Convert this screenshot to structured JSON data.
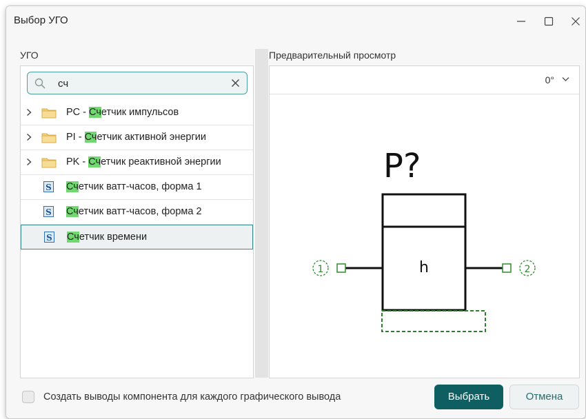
{
  "window": {
    "title": "Выбор УГО"
  },
  "left_panel": {
    "label": "УГО",
    "search": {
      "value": "сч"
    },
    "items": [
      {
        "type": "folder",
        "prefix": "PC - ",
        "match": "Сч",
        "rest": "етчик импульсов",
        "icon": "folder-icon",
        "expandable": true
      },
      {
        "type": "folder",
        "prefix": "PI - ",
        "match": "Сч",
        "rest": "етчик активной энергии",
        "icon": "folder-icon",
        "expandable": true
      },
      {
        "type": "folder",
        "prefix": "PK - ",
        "match": "Сч",
        "rest": "етчик реактивной энергии",
        "icon": "folder-icon",
        "expandable": true
      },
      {
        "type": "symbol",
        "prefix": "",
        "match": "Сч",
        "rest": "етчик ватт-часов, форма 1",
        "icon": "symbol-s-icon",
        "badge": "S"
      },
      {
        "type": "symbol",
        "prefix": "",
        "match": "Сч",
        "rest": "етчик ватт-часов, форма 2",
        "icon": "symbol-s-icon",
        "badge": "S"
      },
      {
        "type": "symbol",
        "prefix": "",
        "match": "Сч",
        "rest": "етчик времени",
        "icon": "symbol-s-icon",
        "badge": "S",
        "selected": true
      }
    ]
  },
  "right_panel": {
    "label": "Предварительный просмотр",
    "rotation": "0°",
    "symbol": {
      "designator": "P?",
      "inner_text": "h",
      "pin_left": "1",
      "pin_right": "2"
    }
  },
  "footer": {
    "checkbox_label": "Создать выводы компонента для каждого графического вывода",
    "checkbox_checked": false,
    "select_button": "Выбрать",
    "cancel_button": "Отмена"
  },
  "colors": {
    "accent": "#0f5f62",
    "search_border": "#4a9ea0",
    "highlight": "#6fd96f",
    "pin_color": "#2e8b2e"
  }
}
